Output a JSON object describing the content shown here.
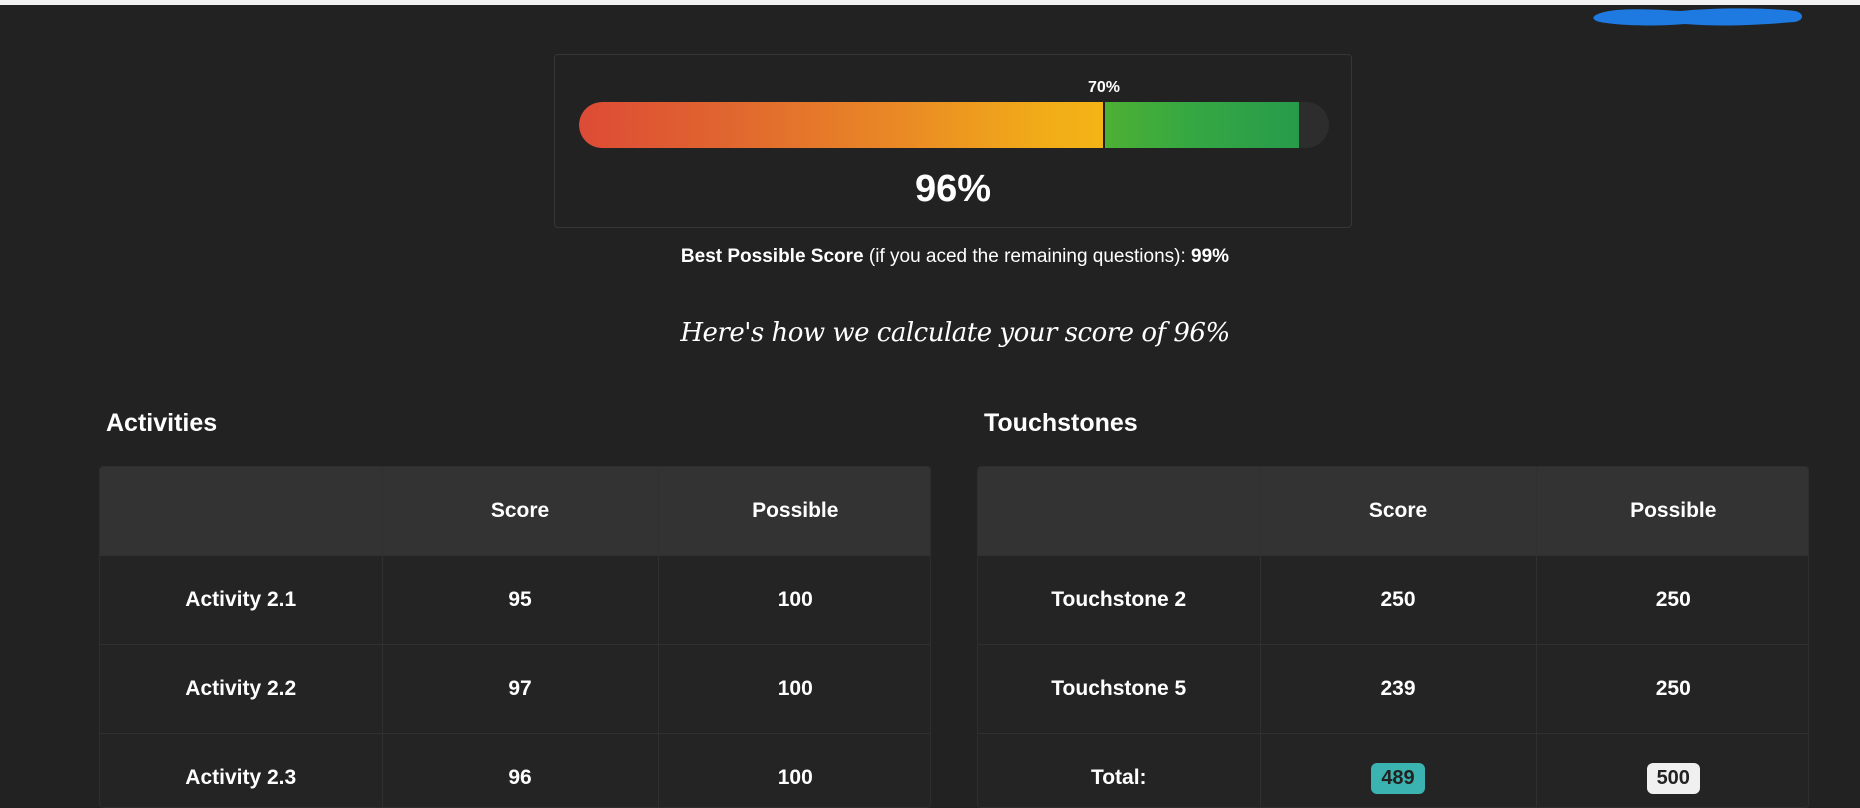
{
  "colors": {
    "background": "#222222",
    "redaction": "#1e7ae0",
    "score_pill": "#3bb3b0",
    "possible_pill": "#f0f0f0"
  },
  "score_bar": {
    "current_score_fraction": 0.96,
    "threshold_fraction": 0.7,
    "threshold_label": "70%",
    "score_text": "96%"
  },
  "best_score": {
    "label": "Best Possible Score",
    "note": " (if you aced the remaining questions): ",
    "value": "99%"
  },
  "calculation_heading": "Here's how we calculate your score of 96%",
  "activities": {
    "title": "Activities",
    "headers": [
      "",
      "Score",
      "Possible"
    ],
    "rows": [
      {
        "name": "Activity 2.1",
        "score": "95",
        "possible": "100"
      },
      {
        "name": "Activity 2.2",
        "score": "97",
        "possible": "100"
      },
      {
        "name": "Activity 2.3",
        "score": "96",
        "possible": "100"
      }
    ]
  },
  "touchstones": {
    "title": "Touchstones",
    "headers": [
      "",
      "Score",
      "Possible"
    ],
    "rows": [
      {
        "name": "Touchstone 2",
        "score": "250",
        "possible": "250"
      },
      {
        "name": "Touchstone 5",
        "score": "239",
        "possible": "250"
      }
    ],
    "total": {
      "label": "Total:",
      "score": "489",
      "possible": "500"
    }
  }
}
